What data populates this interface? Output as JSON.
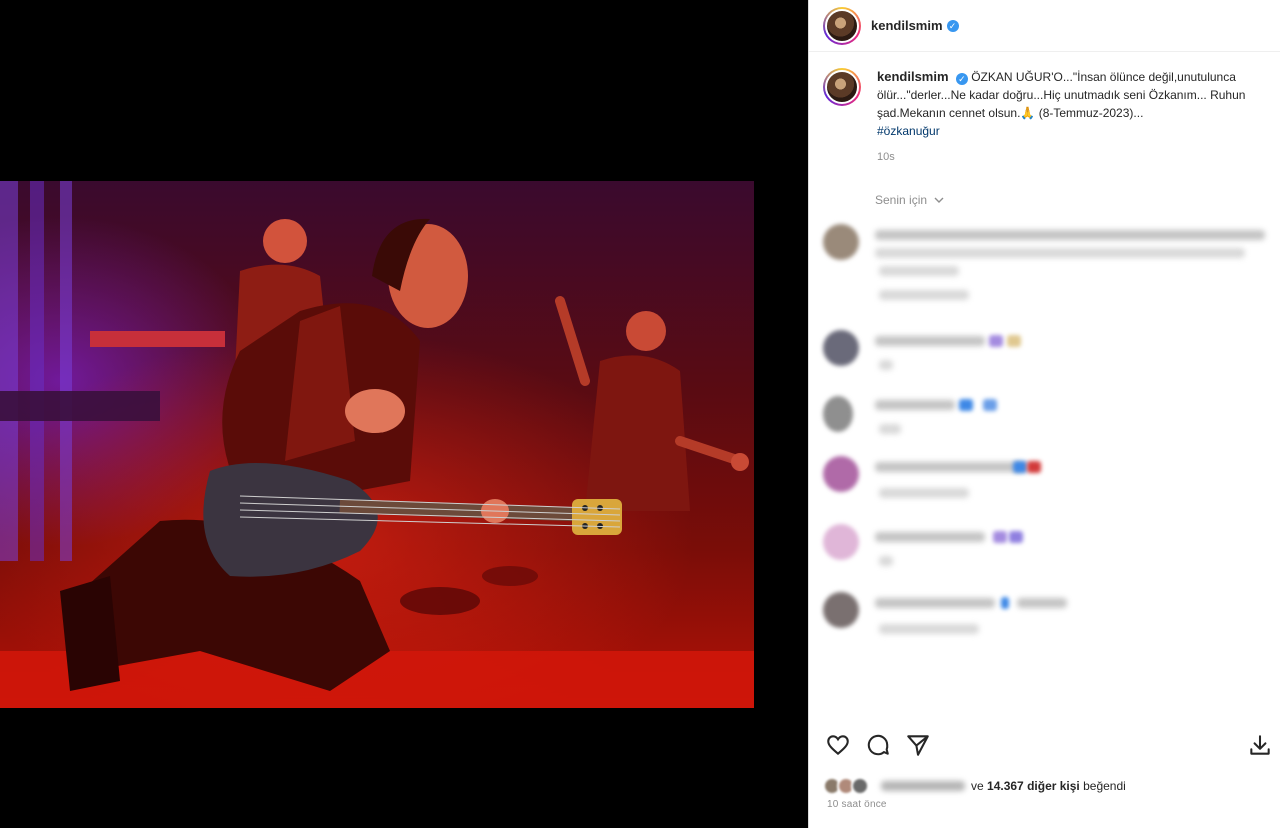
{
  "post": {
    "username": "kendilsmim",
    "verified_mark": "✓",
    "caption": "ÖZKAN UĞUR'O...\"İnsan ölünce değil,unutulunca ölür...\"derler...Ne kadar doğru...Hiç unutmadık seni Özkanım... Ruhun şad.Mekanın cennet olsun.🙏 (8-Temmuz-2023)...",
    "hashtag": "#özkanuğur",
    "caption_time": "10s"
  },
  "comments_section": {
    "sort_label": "Senin için",
    "sort_icon": "chevron-down-icon"
  },
  "actions": {
    "like_icon": "heart-icon",
    "comment_icon": "comment-bubble-icon",
    "share_icon": "paper-plane-icon",
    "save_icon": "download-icon"
  },
  "likes": {
    "connector": "ve",
    "count_text": "14.367 diğer kişi",
    "suffix": "beğendi"
  },
  "posted_time": "10 saat önce",
  "colors": {
    "verified": "#3897f0",
    "hashtag": "#00376b",
    "muted_text": "#8e8e8e"
  }
}
